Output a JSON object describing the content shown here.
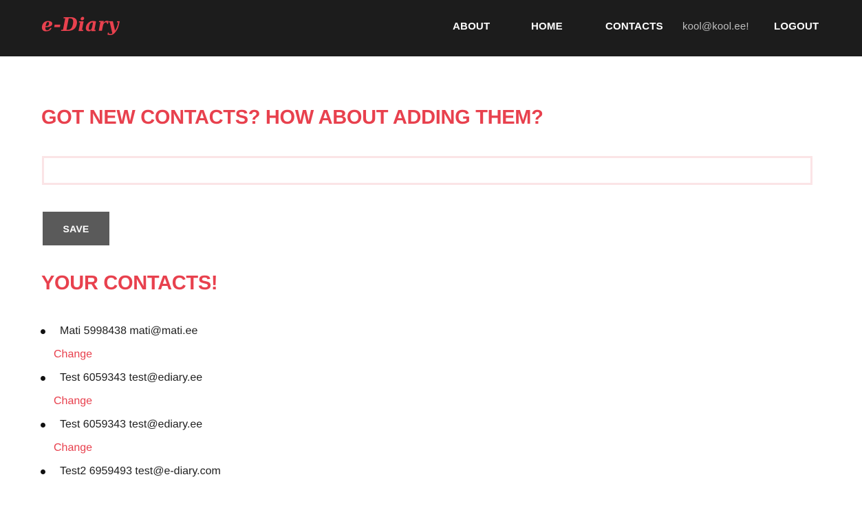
{
  "navbar": {
    "brand": "e-Diary",
    "links": {
      "about": "ABOUT",
      "home": "HOME",
      "contacts": "CONTACTS"
    },
    "user_email": "kool@kool.ee!",
    "logout": "LOGOUT"
  },
  "add_section": {
    "heading": "GOT NEW CONTACTS? HOW ABOUT ADDING THEM?",
    "input_value": "",
    "save_label": "SAVE"
  },
  "contacts_section": {
    "heading": "YOUR CONTACTS!",
    "items": [
      {
        "text": "Mati 5998438 mati@mati.ee",
        "change_label": "Change"
      },
      {
        "text": "Test 6059343 test@ediary.ee",
        "change_label": "Change"
      },
      {
        "text": "Test 6059343 test@ediary.ee",
        "change_label": "Change"
      },
      {
        "text": "Test2 6959493 test@e-diary.com",
        "change_label": ""
      }
    ]
  },
  "colors": {
    "navbar_bg": "#1c1c1c",
    "accent": "#e8414e",
    "button_bg": "#5a5a5a",
    "input_border": "#fbe4e6"
  }
}
